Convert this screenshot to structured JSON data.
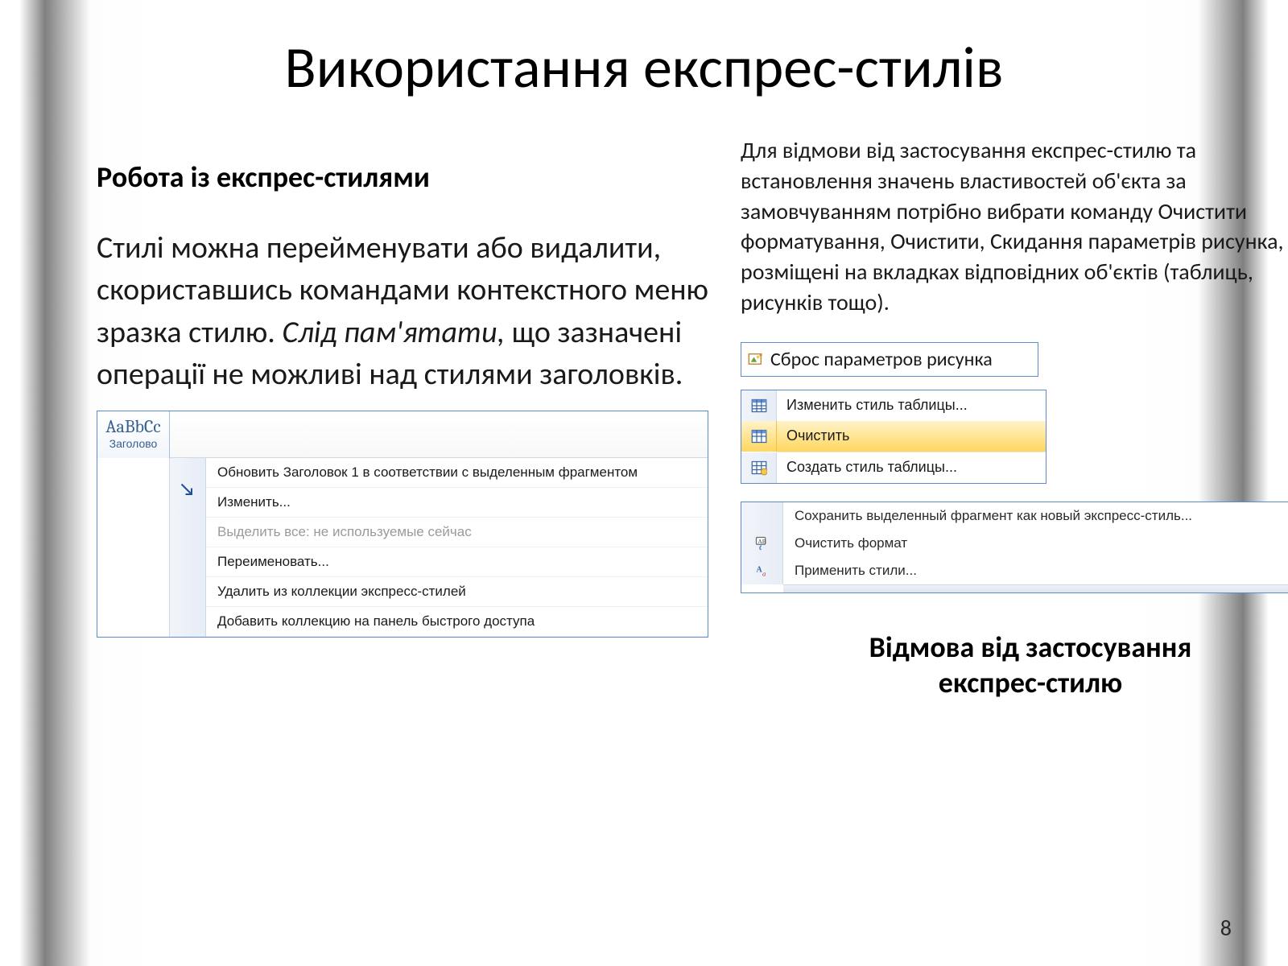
{
  "title": "Використання експрес-стилів",
  "left": {
    "subheading": "Робота із експрес-стилями",
    "para_plain_a": "Стилі можна перейменувати або видалити, скориставшись командами контекстного меню зразка стилю. ",
    "para_italic": "Слід пам'ятати,",
    "para_plain_b": " що зазначені операції не можливі над стилями заголовків."
  },
  "right": {
    "para": "Для відмови від застосування експрес-стилю та встановлення значень властивостей об'єкта за замовчуванням потрібно вибрати команду Очистити форматування, Очистити, Скидання параметрів рисунка, які розміщені на вкладках відповідних об'єктів (таблиць, рисунків тощо).",
    "subheading_line1": "Відмова  від застосування",
    "subheading_line2": "експрес-стилю"
  },
  "ss1": {
    "thumb_sample": "AaBbCc",
    "thumb_label": "Заголово",
    "items": [
      "Обновить Заголовок 1 в соответствии с выделенным фрагментом",
      "Изменить...",
      "Выделить все: не используемые сейчас",
      "Переименовать...",
      "Удалить из коллекции экспресс-стилей",
      "Добавить коллекцию на панель быстрого доступа"
    ]
  },
  "ss2": {
    "label": "Сброс параметров рисунка"
  },
  "ss3": {
    "items": [
      "Изменить стиль таблицы...",
      "Очистить",
      "Создать стиль таблицы..."
    ]
  },
  "ss4": {
    "items": [
      "Сохранить выделенный фрагмент как новый экспресс-стиль...",
      "Очистить формат",
      "Применить стили..."
    ]
  },
  "page_number": "8"
}
